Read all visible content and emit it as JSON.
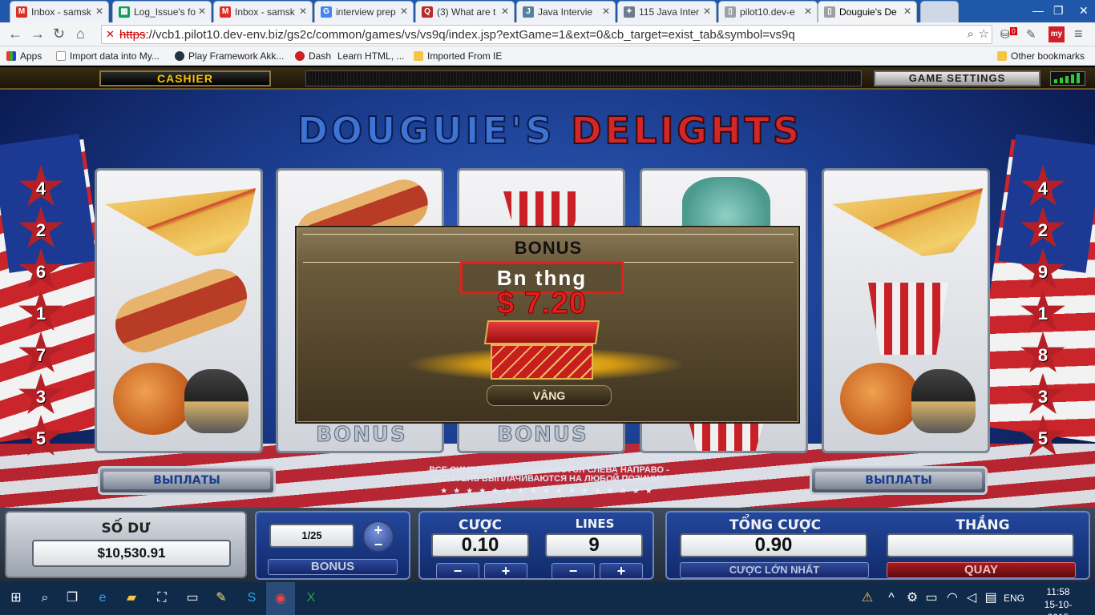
{
  "browser": {
    "tabs": [
      {
        "label": "Inbox - samsk",
        "icon": "gmail-icon",
        "color": "#d93025",
        "glyph": "M"
      },
      {
        "label": "Log_Issue's fo",
        "icon": "sheets-icon",
        "color": "#0f9d58",
        "glyph": "▦"
      },
      {
        "label": "Inbox - samsk",
        "icon": "gmail-icon",
        "color": "#d93025",
        "glyph": "M"
      },
      {
        "label": "interview prep",
        "icon": "google-icon",
        "color": "#4285f4",
        "glyph": "G"
      },
      {
        "label": "(3) What are t",
        "icon": "quora-icon",
        "color": "#b92b27",
        "glyph": "Q"
      },
      {
        "label": "Java Intervie",
        "icon": "java-icon",
        "color": "#5382a1",
        "glyph": "J"
      },
      {
        "label": "115 Java Inter",
        "icon": "puzzle-icon",
        "color": "#6b7c8f",
        "glyph": "✦"
      },
      {
        "label": "pilot10.dev-e",
        "icon": "page-icon",
        "color": "#9aa0a6",
        "glyph": "▯"
      },
      {
        "label": "Douguie's De",
        "icon": "page-icon",
        "color": "#9aa0a6",
        "glyph": "▯"
      }
    ],
    "active_tab": 8,
    "url_scheme": "https",
    "url_rest": "://vcb1.pilot10.dev-env.biz/gs2c/common/games/vs/vs9q/index.jsp?extGame=1&ext=0&cb_target=exist_tab&symbol=vs9q",
    "bookmarks": [
      "Apps",
      "Import data into My...",
      "Play Framework Akk...",
      "Dash",
      "Learn HTML, ...",
      "Imported From IE"
    ],
    "other_bookmarks": "Other bookmarks",
    "ext_badge": "0",
    "ext_my": "my"
  },
  "game": {
    "cashier": "CASHIER",
    "settings": "GAME SETTINGS",
    "title_part1": "DOUGUIE'S",
    "title_part2": "DELIGHTS",
    "left_stars": [
      "4",
      "2",
      "6",
      "1",
      "7",
      "3",
      "5"
    ],
    "right_stars": [
      "4",
      "2",
      "9",
      "1",
      "8",
      "3",
      "5"
    ],
    "bonus_label": "BONUS",
    "payouts_label": "ВЫПЛАТЫ",
    "scatter_line1": "ВСЕ СИМВОЛЫ ВЫПЛАЧИВАЮТСЯ СЛЕВА НАПРАВО -",
    "scatter_line2": "SCATTERS ВЫПЛАЧИВАЮТСЯ НА ЛЮБОЙ ПОЗИЦИИ",
    "stars_row": "★★★★★★★★★★★★★★★★★",
    "balance_label": "SỐ DƯ",
    "balance_value": "$10,530.91",
    "bonus_counter": "1/25",
    "bonus_button": "BONUS",
    "bet_label": "CƯỢC",
    "bet_value": "0.10",
    "lines_label": "LINES",
    "lines_value": "9",
    "total_bet_label": "TỔNG CƯỢC",
    "total_bet_value": "0.90",
    "win_label": "THẮNG",
    "win_value": "",
    "max_bet_button": "CƯỢC LỚN NHẤT",
    "spin_button": "QUAY",
    "minus": "−",
    "plus": "+"
  },
  "popup": {
    "title": "BONUS",
    "win_text": "Bn  thng",
    "amount": "$ 7.20",
    "ok_button": "VÂNG"
  },
  "taskbar": {
    "language": "ENG",
    "time": "11:58",
    "date": "15-10-2015"
  },
  "colors": {
    "accent": "#f7c400",
    "danger": "#e81c1c",
    "taskbar": "#102a4a"
  }
}
